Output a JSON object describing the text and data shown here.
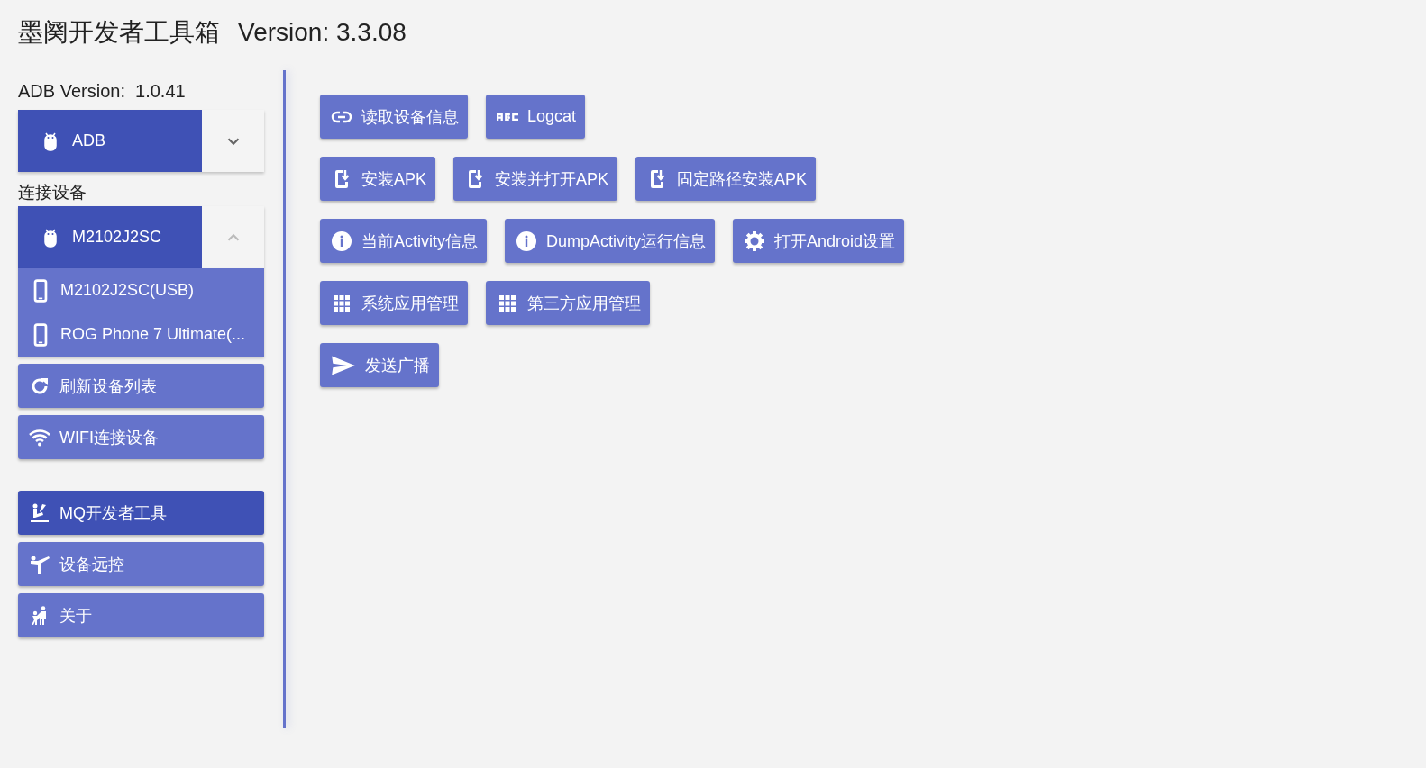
{
  "header": {
    "title": "墨阕开发者工具箱",
    "version": "Version: 3.3.08"
  },
  "sidebar": {
    "adb_version": "ADB Version:  1.0.41",
    "adb_select": {
      "value": "ADB",
      "expanded": false
    },
    "devices_label": "连接设备",
    "device_select": {
      "value": "M2102J2SC",
      "expanded": true,
      "options": [
        {
          "label": "M2102J2SC(USB)"
        },
        {
          "label": "ROG Phone 7 Ultimate(..."
        }
      ]
    },
    "actions": [
      {
        "label": "刷新设备列表",
        "kind": "refresh"
      },
      {
        "label": "WIFI连接设备",
        "kind": "wifi"
      }
    ],
    "nav": [
      {
        "label": "MQ开发者工具",
        "kind": "rower",
        "selected": true
      },
      {
        "label": "设备远控",
        "kind": "kick",
        "selected": false
      },
      {
        "label": "关于",
        "kind": "people",
        "selected": false
      }
    ]
  },
  "tool_rows": [
    [
      {
        "label": "读取设备信息",
        "kind": "link"
      },
      {
        "label": "Logcat",
        "kind": "abc"
      }
    ],
    [
      {
        "label": "安装APK",
        "kind": "install"
      },
      {
        "label": "安装并打开APK",
        "kind": "install"
      },
      {
        "label": "固定路径安装APK",
        "kind": "install"
      }
    ],
    [
      {
        "label": "当前Activity信息",
        "kind": "info"
      },
      {
        "label": "DumpActivity运行信息",
        "kind": "info"
      },
      {
        "label": "打开Android设置",
        "kind": "gear"
      }
    ],
    [
      {
        "label": "系统应用管理",
        "kind": "grid"
      },
      {
        "label": "第三方应用管理",
        "kind": "grid"
      }
    ],
    [
      {
        "label": "发送广播",
        "kind": "send"
      }
    ]
  ]
}
